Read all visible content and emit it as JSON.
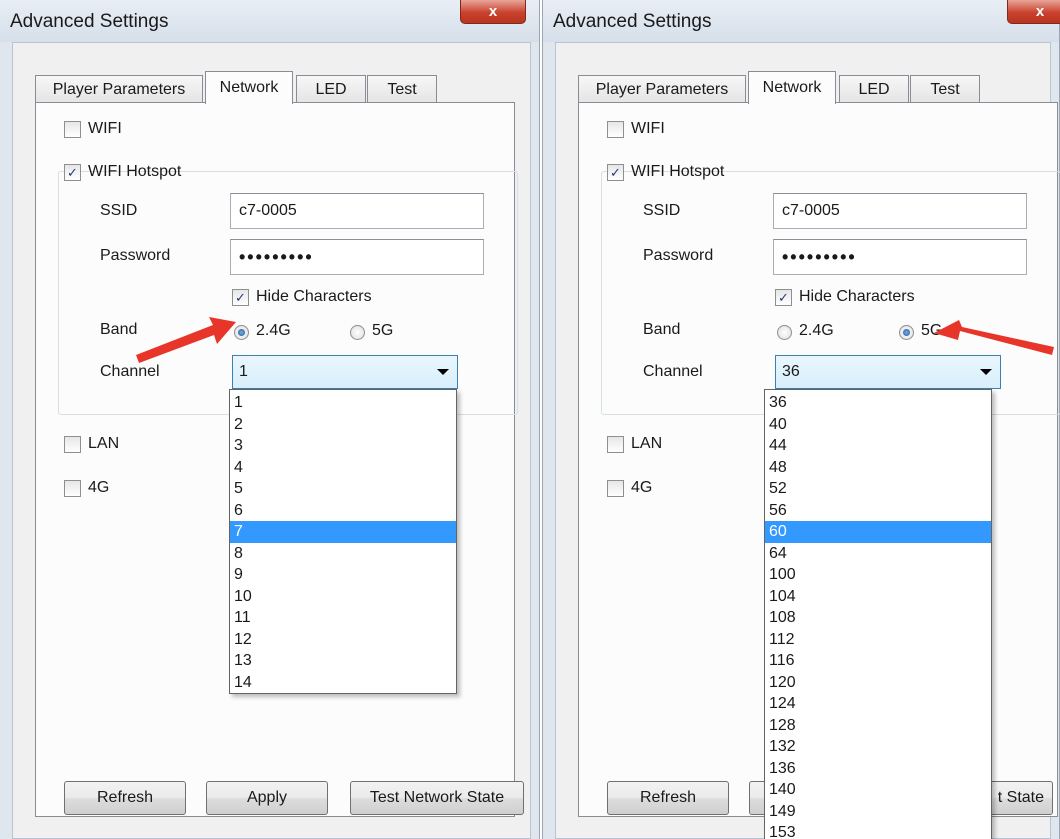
{
  "left_window": {
    "title": "Advanced Settings",
    "close_label": "x",
    "tabs": [
      {
        "label": "Player Parameters",
        "active": false
      },
      {
        "label": "Network",
        "active": true
      },
      {
        "label": "LED",
        "active": false
      },
      {
        "label": "Test",
        "active": false
      }
    ],
    "wifi": {
      "label": "WIFI",
      "checked": false
    },
    "hotspot": {
      "label": "WIFI Hotspot",
      "checked": true
    },
    "ssid": {
      "label": "SSID",
      "value": "c7-0005"
    },
    "password": {
      "label": "Password",
      "value": "•••••••••"
    },
    "hide_chars": {
      "label": "Hide Characters",
      "checked": true
    },
    "band": {
      "label": "Band",
      "option_24": "2.4G",
      "option_5": "5G",
      "selected": "2.4G"
    },
    "channel": {
      "label": "Channel",
      "value": "1"
    },
    "channel_options": [
      "1",
      "2",
      "3",
      "4",
      "5",
      "6",
      "7",
      "8",
      "9",
      "10",
      "11",
      "12",
      "13",
      "14"
    ],
    "channel_highlighted": "7",
    "lan": {
      "label": "LAN",
      "checked": false
    },
    "lte": {
      "label": "4G",
      "checked": false
    },
    "buttons": {
      "refresh": "Refresh",
      "apply": "Apply",
      "test": "Test Network State"
    },
    "annotation_color": "#e8352a"
  },
  "right_window": {
    "title": "Advanced Settings",
    "close_label": "x",
    "tabs": [
      {
        "label": "Player Parameters",
        "active": false
      },
      {
        "label": "Network",
        "active": true
      },
      {
        "label": "LED",
        "active": false
      },
      {
        "label": "Test",
        "active": false
      }
    ],
    "wifi": {
      "label": "WIFI",
      "checked": false
    },
    "hotspot": {
      "label": "WIFI Hotspot",
      "checked": true
    },
    "ssid": {
      "label": "SSID",
      "value": "c7-0005"
    },
    "password": {
      "label": "Password",
      "value": "•••••••••"
    },
    "hide_chars": {
      "label": "Hide Characters",
      "checked": true
    },
    "band": {
      "label": "Band",
      "option_24": "2.4G",
      "option_5": "5G",
      "selected": "5G"
    },
    "channel": {
      "label": "Channel",
      "value": "36"
    },
    "channel_options": [
      "36",
      "40",
      "44",
      "48",
      "52",
      "56",
      "60",
      "64",
      "100",
      "104",
      "108",
      "112",
      "116",
      "120",
      "124",
      "128",
      "132",
      "136",
      "140",
      "149",
      "153"
    ],
    "channel_highlighted": "60",
    "lan": {
      "label": "LAN",
      "checked": false
    },
    "lte": {
      "label": "4G",
      "checked": false
    },
    "buttons": {
      "refresh": "Refresh",
      "test_partial": "t State"
    },
    "annotation_color": "#e8352a"
  }
}
